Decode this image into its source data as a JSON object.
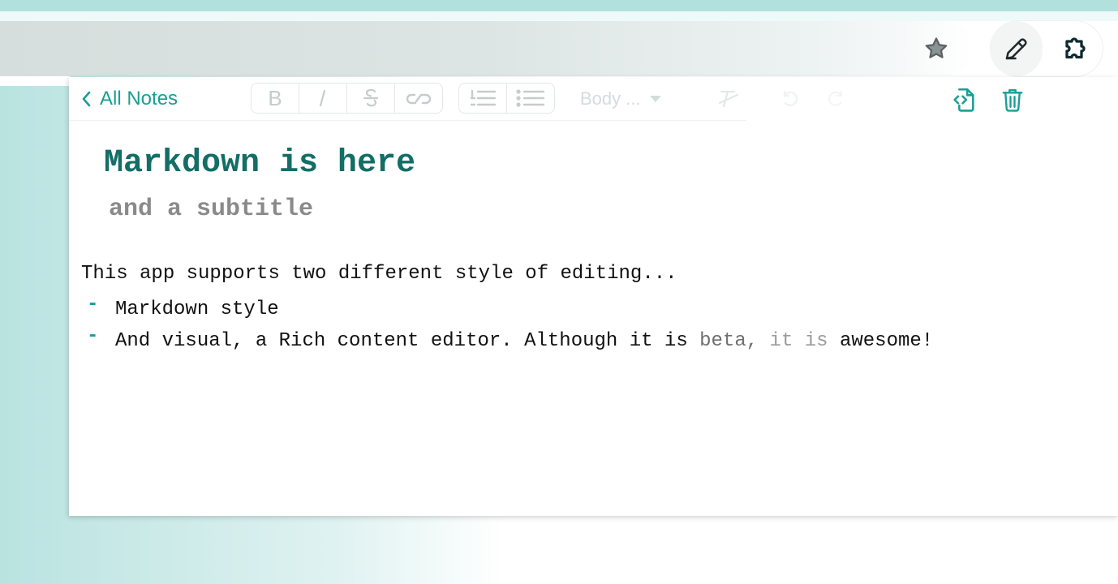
{
  "browser": {
    "bookmark_icon": "star-icon",
    "extension_icons": [
      "pencil-icon",
      "puzzle-icon"
    ]
  },
  "toolbar": {
    "back_label": "All Notes",
    "back_icon": "chevron-left-icon",
    "text_format_buttons": [
      "bold-icon",
      "italic-icon",
      "strikethrough-icon",
      "link-icon"
    ],
    "list_buttons": [
      "ordered-list-icon",
      "bullet-list-icon"
    ],
    "format_select": "Body ...",
    "history_buttons": [
      "clear-format-icon",
      "undo-icon",
      "redo-icon"
    ],
    "actions": [
      "source-code-icon",
      "trash-icon"
    ]
  },
  "note": {
    "title": "Markdown is here",
    "subtitle": "and a subtitle",
    "intro": "This app supports two different style of editing...",
    "list": [
      {
        "marker": "-",
        "text": "Markdown style"
      },
      {
        "marker": "-",
        "text_start": "And visual, a Rich content editor. Although it is ",
        "text_fade1": "beta, ",
        "text_fade2": "it is",
        "text_end": " awesome!"
      }
    ]
  },
  "colors": {
    "accent": "#1a9e94",
    "title": "#136e66",
    "subtitle": "#8a8a8a",
    "text": "#111111"
  }
}
